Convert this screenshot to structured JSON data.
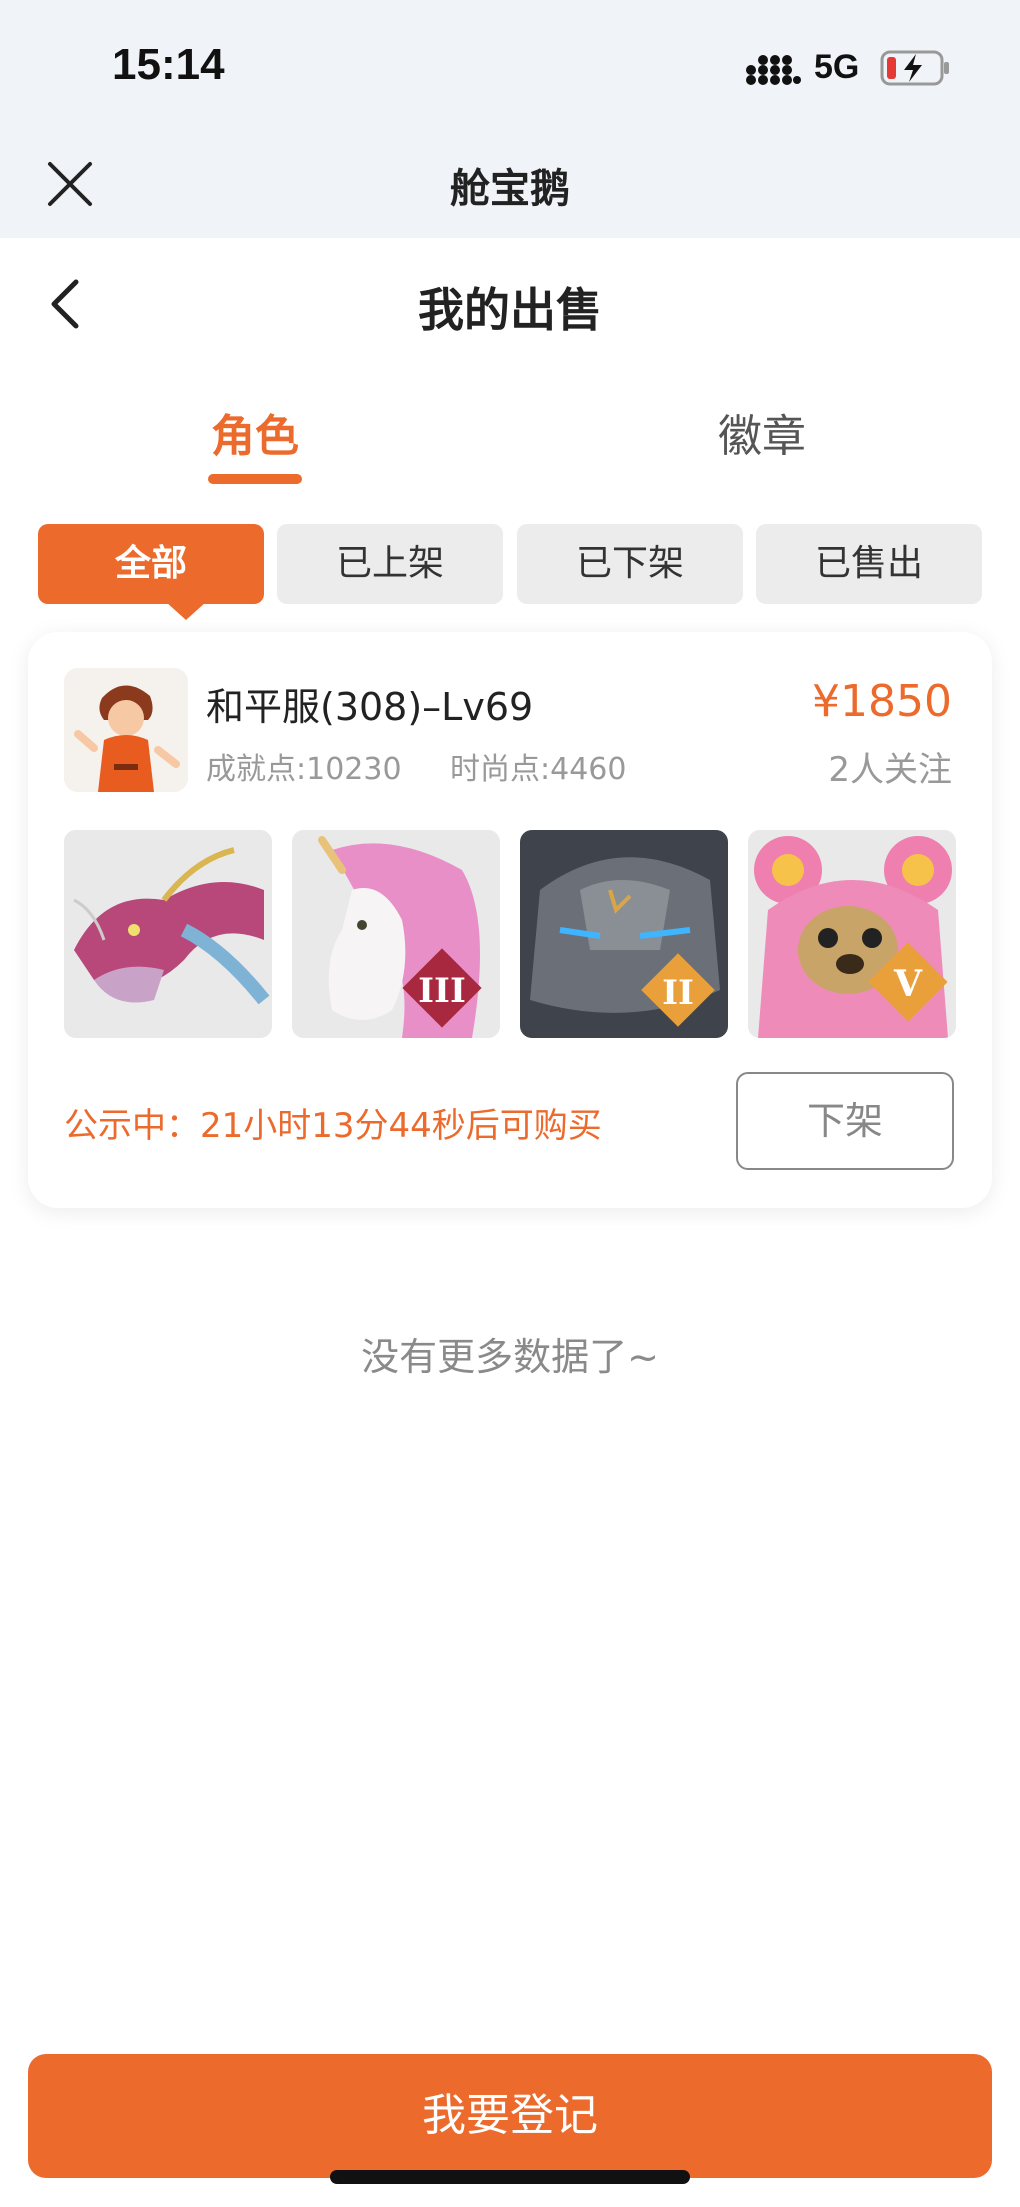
{
  "status_bar": {
    "time": "15:14",
    "network": "5G",
    "icons": [
      "signal-icon",
      "battery-charging-icon"
    ]
  },
  "app_bar": {
    "title": "舱宝鹅",
    "close_icon": "close-icon"
  },
  "page": {
    "title": "我的出售",
    "back_icon": "chevron-left-icon"
  },
  "tabs": [
    {
      "label": "角色",
      "active": true
    },
    {
      "label": "徽章",
      "active": false
    }
  ],
  "filters": [
    {
      "label": "全部",
      "active": true
    },
    {
      "label": "已上架",
      "active": false
    },
    {
      "label": "已下架",
      "active": false
    },
    {
      "label": "已售出",
      "active": false
    }
  ],
  "listing": {
    "name": "和平服(308)–Lv69",
    "achievement": "成就点:10230",
    "fashion": "时尚点:4460",
    "price": "¥1850",
    "followers": "2人关注",
    "items": [
      {
        "name": "dragon-mount",
        "badge": ""
      },
      {
        "name": "unicorn-mount",
        "badge": "III"
      },
      {
        "name": "stone-golem",
        "badge": "II"
      },
      {
        "name": "pink-bear",
        "badge": "V"
      }
    ],
    "notice": "公示中：21小时13分44秒后可购买",
    "delist_label": "下架"
  },
  "footer_text": "没有更多数据了~",
  "register_label": "我要登记",
  "colors": {
    "accent": "#ec6a2c",
    "background": "#f0f3f7"
  }
}
